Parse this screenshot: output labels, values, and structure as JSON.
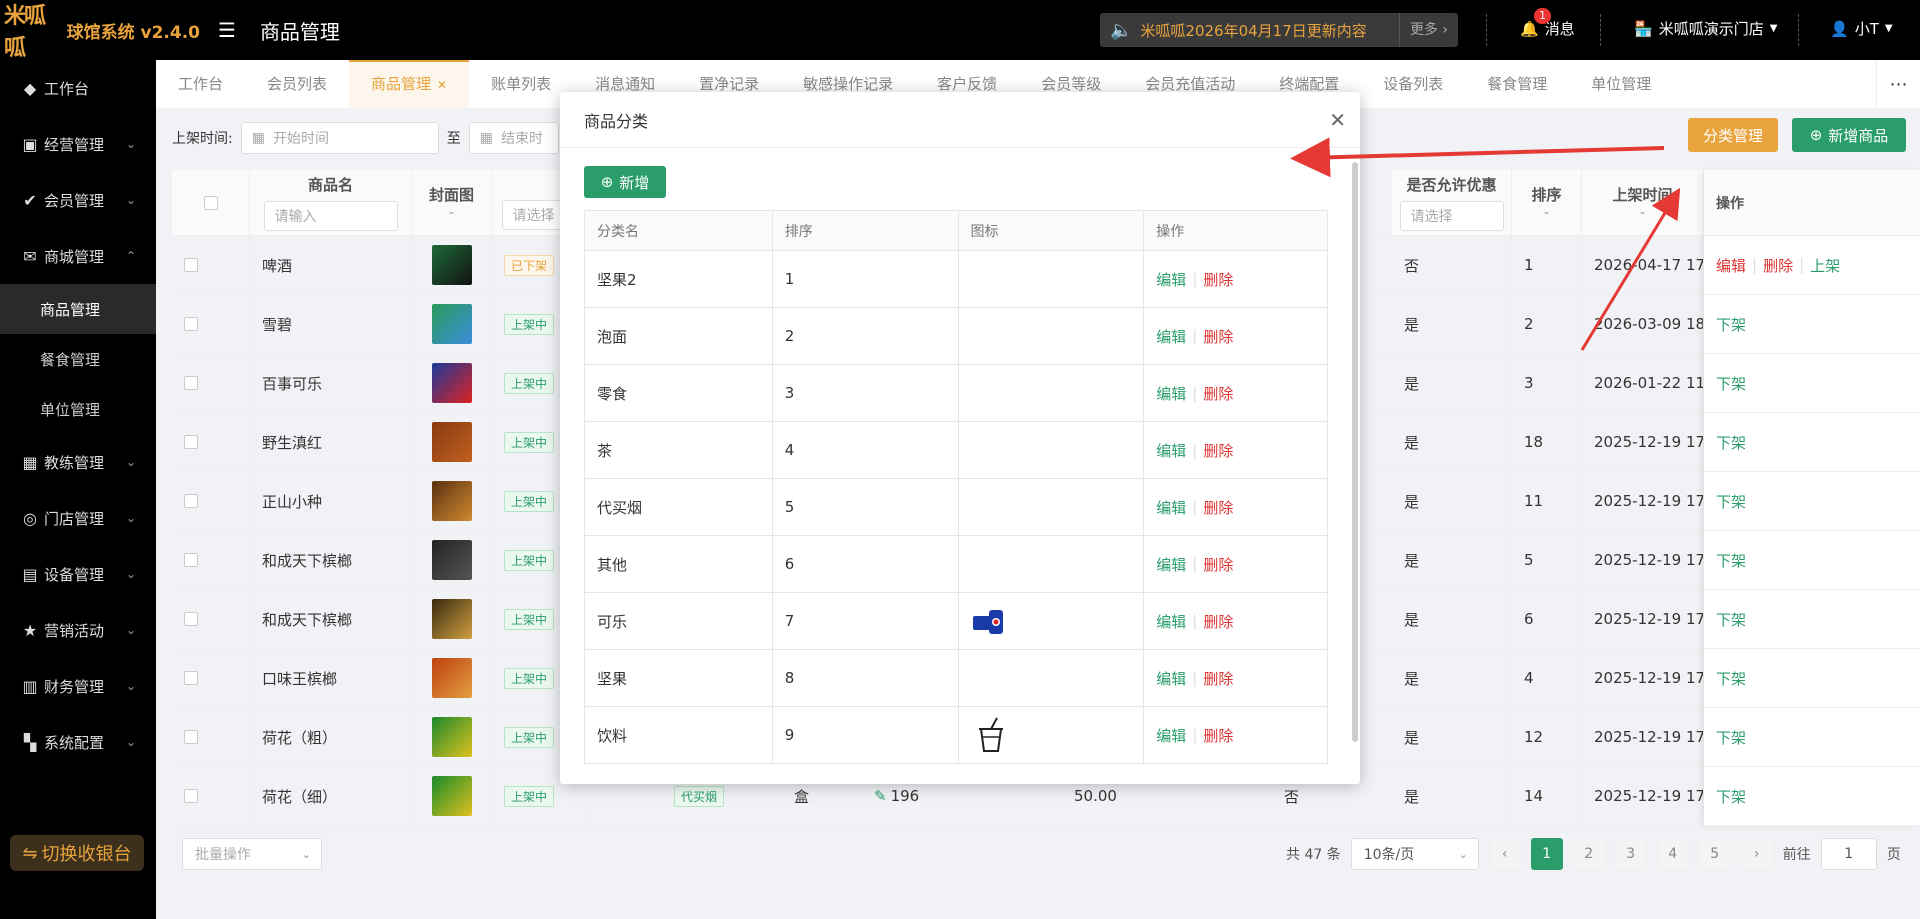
{
  "app": {
    "logo_text": "米呱呱",
    "title": "球馆系统 v2.4.0",
    "page_title": "商品管理",
    "notice_text": "米呱呱2026年04月17日更新内容",
    "notice_more": "更多",
    "messages_label": "消息",
    "messages_badge": "1",
    "store_label": "米呱呱演示门店",
    "user_label": "小T"
  },
  "sidebar": {
    "items": [
      {
        "label": "工作台",
        "icon": "cube-icon"
      },
      {
        "label": "经营管理",
        "icon": "chart-icon"
      },
      {
        "label": "会员管理",
        "icon": "check-icon"
      },
      {
        "label": "商城管理",
        "icon": "mail-icon"
      }
    ],
    "sub_items": [
      "商品管理",
      "餐食管理",
      "单位管理"
    ],
    "items_after": [
      {
        "label": "教练管理",
        "icon": "coach-icon"
      },
      {
        "label": "门店管理",
        "icon": "store-icon"
      },
      {
        "label": "设备管理",
        "icon": "device-icon"
      },
      {
        "label": "营销活动",
        "icon": "star-icon"
      },
      {
        "label": "财务管理",
        "icon": "finance-icon"
      },
      {
        "label": "系统配置",
        "icon": "grid-icon"
      }
    ],
    "switch_label": "切换收银台"
  },
  "tabs": [
    "工作台",
    "会员列表",
    "商品管理",
    "账单列表",
    "消息通知",
    "置净记录",
    "敏感操作记录",
    "客户反馈",
    "会员等级",
    "会员充值活动",
    "终端配置",
    "设备列表",
    "餐食管理",
    "单位管理"
  ],
  "filter": {
    "label": "上架时间:",
    "start_placeholder": "开始时间",
    "to": "至",
    "end_placeholder": "结束时"
  },
  "buttons": {
    "category_manage": "分类管理",
    "add_product": "新增商品"
  },
  "main_table": {
    "headers": {
      "name": "商品名",
      "name_placeholder": "请输入",
      "cover": "封面图",
      "cover_sub": "-",
      "status_placeholder": "请选择",
      "allow_discount": "是否允许优惠",
      "allow_placeholder": "请选择",
      "sort": "排序",
      "sort_sub": "-",
      "shelf_time": "上架时间",
      "shelf_sub": "-",
      "ops": "操作"
    },
    "rows": [
      {
        "name": "啤酒",
        "status": "已下架",
        "allow": "否",
        "sort": "1",
        "time": "2026-04-17 17",
        "ops": [
          "编辑",
          "删除",
          "上架"
        ]
      },
      {
        "name": "雪碧",
        "status": "上架中",
        "allow": "是",
        "sort": "2",
        "time": "2026-03-09 18",
        "ops": [
          "下架"
        ]
      },
      {
        "name": "百事可乐",
        "status": "上架中",
        "allow": "是",
        "sort": "3",
        "time": "2026-01-22 11",
        "ops": [
          "下架"
        ]
      },
      {
        "name": "野生滇红",
        "status": "上架中",
        "allow": "是",
        "sort": "18",
        "time": "2025-12-19 17",
        "ops": [
          "下架"
        ]
      },
      {
        "name": "正山小种",
        "status": "上架中",
        "allow": "是",
        "sort": "11",
        "time": "2025-12-19 17",
        "ops": [
          "下架"
        ]
      },
      {
        "name": "和成天下槟榔",
        "status": "上架中",
        "allow": "是",
        "sort": "5",
        "time": "2025-12-19 17",
        "ops": [
          "下架"
        ]
      },
      {
        "name": "和成天下槟榔",
        "status": "上架中",
        "allow": "是",
        "sort": "6",
        "time": "2025-12-19 17",
        "ops": [
          "下架"
        ]
      },
      {
        "name": "口味王槟榔",
        "status": "上架中",
        "allow": "是",
        "sort": "4",
        "time": "2025-12-19 17",
        "ops": [
          "下架"
        ]
      },
      {
        "name": "荷花（粗）",
        "status": "上架中",
        "allow": "是",
        "sort": "12",
        "time": "2025-12-19 17",
        "ops": [
          "下架"
        ]
      },
      {
        "name": "荷花（细）",
        "status": "上架中",
        "allow": "是",
        "sort": "14",
        "time": "2025-12-19 17",
        "ops": [
          "下架"
        ],
        "category": "代买烟",
        "unit": "盒",
        "stock": "196",
        "price": "50.00",
        "member_price_flag": "否"
      }
    ]
  },
  "bottom": {
    "bulk_placeholder": "批量操作",
    "total": "共 47 条",
    "page_size": "10条/页",
    "pages": [
      "1",
      "2",
      "3",
      "4",
      "5"
    ],
    "goto_label": "前往",
    "goto_value": "1",
    "page_suffix": "页"
  },
  "dialog": {
    "title": "商品分类",
    "add_label": "新增",
    "headers": [
      "分类名",
      "排序",
      "图标",
      "操作"
    ],
    "edit_label": "编辑",
    "delete_label": "删除",
    "rows": [
      {
        "name": "坚果2",
        "sort": "1",
        "icon": ""
      },
      {
        "name": "泡面",
        "sort": "2",
        "icon": ""
      },
      {
        "name": "零食",
        "sort": "3",
        "icon": ""
      },
      {
        "name": "茶",
        "sort": "4",
        "icon": ""
      },
      {
        "name": "代买烟",
        "sort": "5",
        "icon": ""
      },
      {
        "name": "其他",
        "sort": "6",
        "icon": ""
      },
      {
        "name": "可乐",
        "sort": "7",
        "icon": "cola-can-icon"
      },
      {
        "name": "坚果",
        "sort": "8",
        "icon": ""
      },
      {
        "name": "饮料",
        "sort": "9",
        "icon": "drink-cup-icon"
      }
    ]
  },
  "colors": {
    "accent_orange": "#e8a33d",
    "primary_green": "#2a9d6b",
    "danger_red": "#d33333",
    "annotation_red": "#e53935"
  }
}
